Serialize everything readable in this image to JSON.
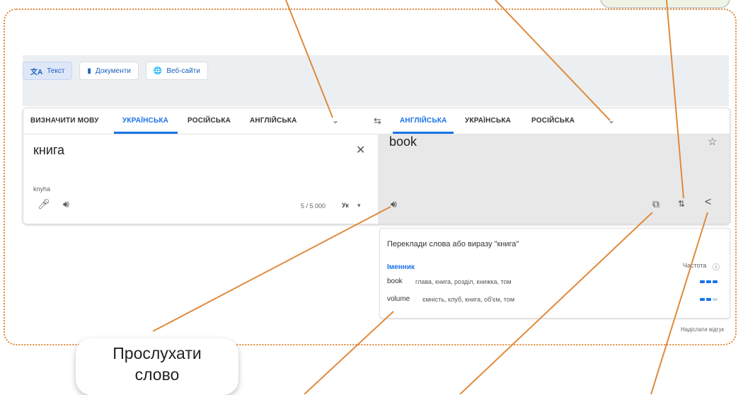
{
  "mode_tabs": {
    "text": "Текст",
    "documents": "Документи",
    "websites": "Веб-сайти"
  },
  "source_langs": [
    "ВИЗНАЧИТИ МОВУ",
    "УКРАЇНСЬКА",
    "РОСІЙСЬКА",
    "АНГЛІЙСЬКА"
  ],
  "target_langs": [
    "АНГЛІЙСЬКА",
    "УКРАЇНСЬКА",
    "РОСІЙСЬКА"
  ],
  "source": {
    "text": "книга",
    "transliteration": "knyha",
    "char_count": "5 / 5 000",
    "input_tool": "Ук"
  },
  "target": {
    "text": "book"
  },
  "dictionary": {
    "heading": "Переклади слова або виразу \"книга\"",
    "pos": "Іменник",
    "frequency_label": "Частота",
    "entries": [
      {
        "word": "book",
        "synonyms": "глава, книга, розділ, книжка, том",
        "frequency": 3
      },
      {
        "word": "volume",
        "synonyms": "ємність, клуб, книга, об'єм, том",
        "frequency": 2
      }
    ],
    "feedback": "Надіслати відгук"
  },
  "callout": {
    "line1": "Прослухати",
    "line2": "слово"
  },
  "colors": {
    "accent": "#1a73e8",
    "annotation_line": "#e08a3c",
    "frame_border": "#e08a3c"
  }
}
